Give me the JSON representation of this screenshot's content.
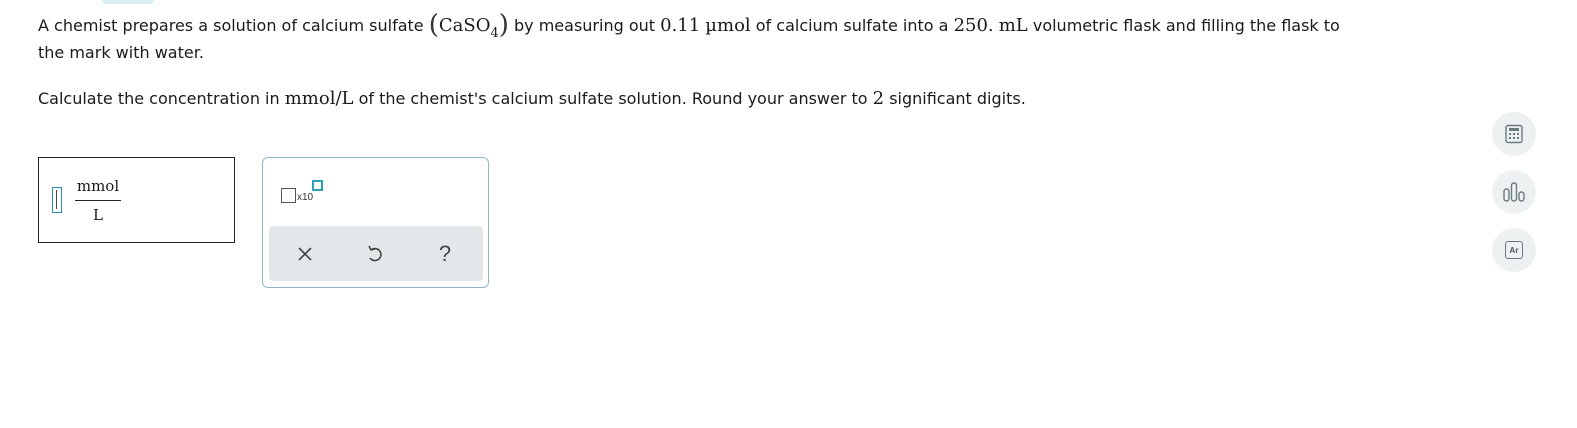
{
  "question": {
    "line1": {
      "before": "A chemist prepares a solution of calcium sulfate ",
      "formula_main": "CaSO",
      "formula_sub": "4",
      "mid1": " by measuring out ",
      "amount": "0.11",
      "amount_unit": "µmol",
      "mid2": " of calcium sulfate into a ",
      "volume": "250.",
      "volume_unit": "mL",
      "after": " volumetric flask and filling the flask to"
    },
    "line2": "the mark with water.",
    "line3": {
      "before": "Calculate the concentration in ",
      "unit": "mmol/L",
      "mid": " of the chemist's calcium sulfate solution. Round your answer to ",
      "sig_figs": "2",
      "after": " significant digits."
    }
  },
  "answer": {
    "value": "",
    "unit_numerator": "mmol",
    "unit_denominator": "L"
  },
  "palette": {
    "sci_notation_label": "x10"
  },
  "side_tools": [
    "calculator-icon",
    "chart-icon",
    "periodic-table-icon"
  ],
  "periodic_icon_text": "Ar",
  "colors": {
    "accent": "#2aa0b4",
    "palette_border": "#8fb8c8",
    "tool_row_bg": "#e2e8ea",
    "side_tool_bg": "#eef1f2"
  }
}
